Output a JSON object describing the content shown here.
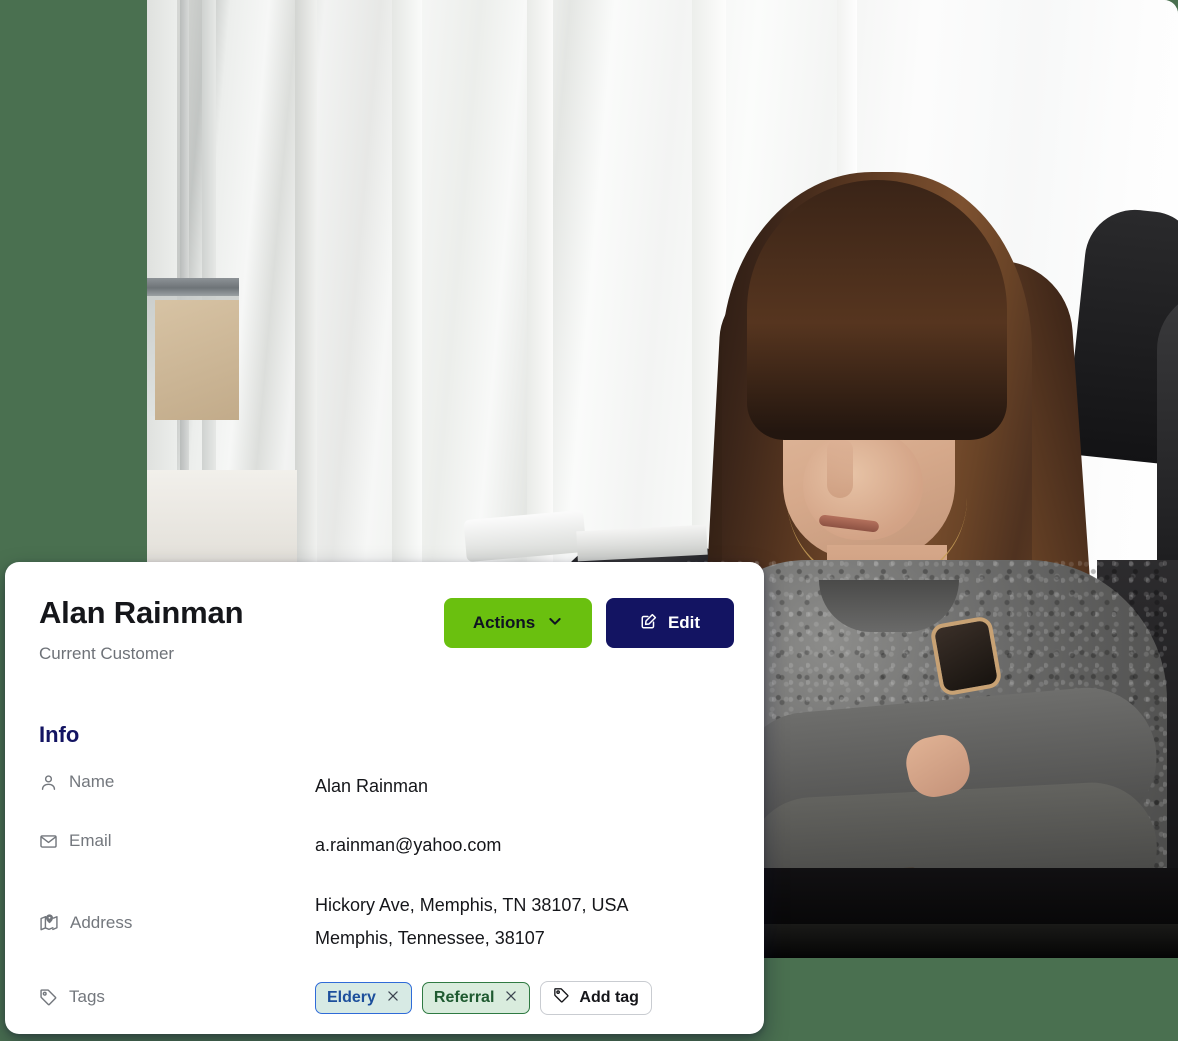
{
  "theme": {
    "page_background": "#4a7050",
    "card_background": "#ffffff",
    "accent_navy": "#131462",
    "accent_green": "#6ac00f",
    "muted_text": "#6e7278"
  },
  "photo": {
    "alt_description": "Woman with long brown hair and bangs in a gray knit sweater standing with arms crossed beside bright store windows"
  },
  "customer": {
    "name": "Alan Rainman",
    "status": "Current Customer"
  },
  "header_buttons": {
    "actions_label": "Actions",
    "actions_icon": "chevron-down-icon",
    "edit_label": "Edit",
    "edit_icon": "edit-pencil-icon"
  },
  "info": {
    "section_title": "Info",
    "rows": [
      {
        "icon": "person-icon",
        "label": "Name",
        "value": "Alan Rainman"
      },
      {
        "icon": "envelope-icon",
        "label": "Email",
        "value": "a.rainman@yahoo.com"
      },
      {
        "icon": "map-pin-icon",
        "label": "Address",
        "value_line1": "Hickory Ave, Memphis, TN 38107, USA",
        "value_line2": "Memphis, Tennessee, 38107"
      },
      {
        "icon": "tag-icon",
        "label": "Tags"
      }
    ]
  },
  "tags": {
    "items": [
      {
        "label": "Eldery",
        "remove_icon": "close-icon",
        "border_color": "#2f6bd8",
        "background": "#d7eae4",
        "text_color": "#1c4f9c"
      },
      {
        "label": "Referral",
        "remove_icon": "close-icon",
        "border_color": "#2f7a42",
        "background": "#d9ecdd",
        "text_color": "#1f5a30"
      }
    ],
    "add_label": "Add tag",
    "add_icon": "tag-icon"
  }
}
